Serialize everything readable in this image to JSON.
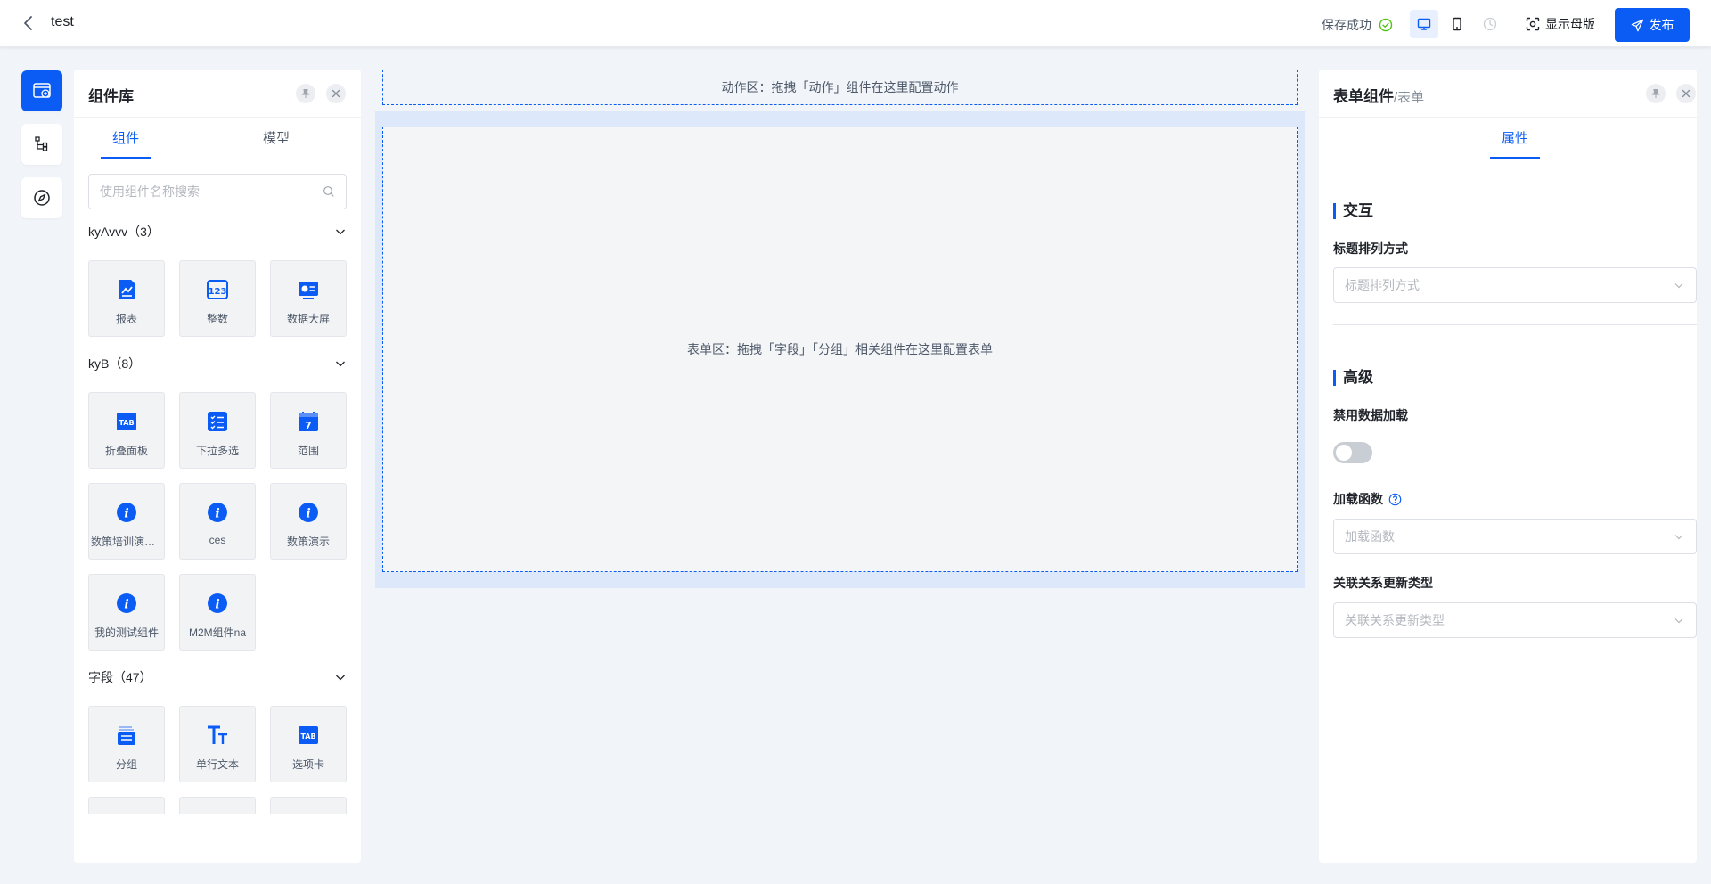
{
  "header": {
    "title": "test",
    "save_status": "保存成功",
    "show_master_label": "显示母版",
    "publish_label": "发布"
  },
  "library": {
    "title": "组件库",
    "tabs": [
      {
        "label": "组件"
      },
      {
        "label": "模型"
      }
    ],
    "search_placeholder": "使用组件名称搜索",
    "groups": [
      {
        "label": "kyAvvv（3）",
        "items": [
          {
            "label": "报表",
            "icon": "report-icon"
          },
          {
            "label": "整数",
            "icon": "integer-123-icon"
          },
          {
            "label": "数据大屏",
            "icon": "data-screen-icon"
          }
        ]
      },
      {
        "label": "kyB（8）",
        "items": [
          {
            "label": "折叠面板",
            "icon": "tab-icon"
          },
          {
            "label": "下拉多选",
            "icon": "checklist-icon"
          },
          {
            "label": "范围",
            "icon": "calendar-icon"
          },
          {
            "label": "数策培训演示组件",
            "icon": "info-icon"
          },
          {
            "label": "ces",
            "icon": "info-icon"
          },
          {
            "label": "数策演示",
            "icon": "info-icon"
          },
          {
            "label": "我的测试组件",
            "icon": "info-icon"
          },
          {
            "label": "M2M组件na",
            "icon": "info-icon"
          }
        ]
      },
      {
        "label": "字段（47）",
        "items": [
          {
            "label": "分组",
            "icon": "group-icon"
          },
          {
            "label": "单行文本",
            "icon": "text-icon"
          },
          {
            "label": "选项卡",
            "icon": "tab-icon"
          }
        ]
      }
    ]
  },
  "canvas": {
    "action_zone_text": "动作区：拖拽「动作」组件在这里配置动作",
    "form_zone_text": "表单区：拖拽「字段」「分组」相关组件在这里配置表单"
  },
  "properties": {
    "title": "表单组件",
    "subtitle": "/表单",
    "tab_label": "属性",
    "section_interaction": "交互",
    "title_layout_label": "标题排列方式",
    "title_layout_placeholder": "标题排列方式",
    "section_advanced": "高级",
    "disable_loading_label": "禁用数据加载",
    "disable_loading_on": false,
    "load_function_label": "加载函数",
    "load_function_placeholder": "加载函数",
    "relation_update_label": "关联关系更新类型",
    "relation_update_placeholder": "关联关系更新类型"
  },
  "colors": {
    "accent": "#0a5cf5",
    "success": "#52c41a",
    "canvas_highlight": "#dde9fa"
  }
}
